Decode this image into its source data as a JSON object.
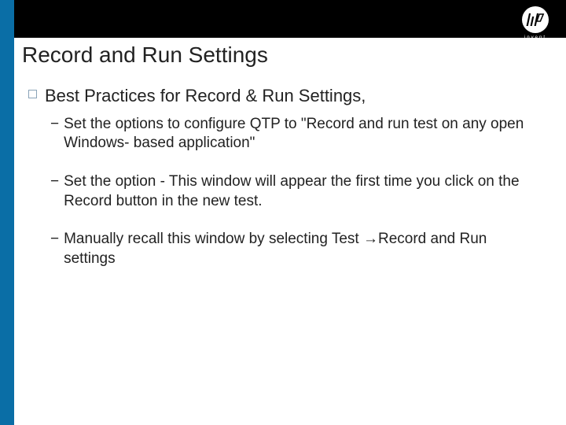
{
  "logo": {
    "tagline": "invent"
  },
  "title": "Record and Run Settings",
  "main_bullet": "Best Practices for Record & Run Settings,",
  "sub_items": [
    "Set the options to configure QTP to \"Record and run test on any open Windows- based application\"",
    "Set the option - This window will appear the first time you click on the Record button in the new test.",
    "Manually recall this window by selecting Test →Record and Run settings"
  ]
}
